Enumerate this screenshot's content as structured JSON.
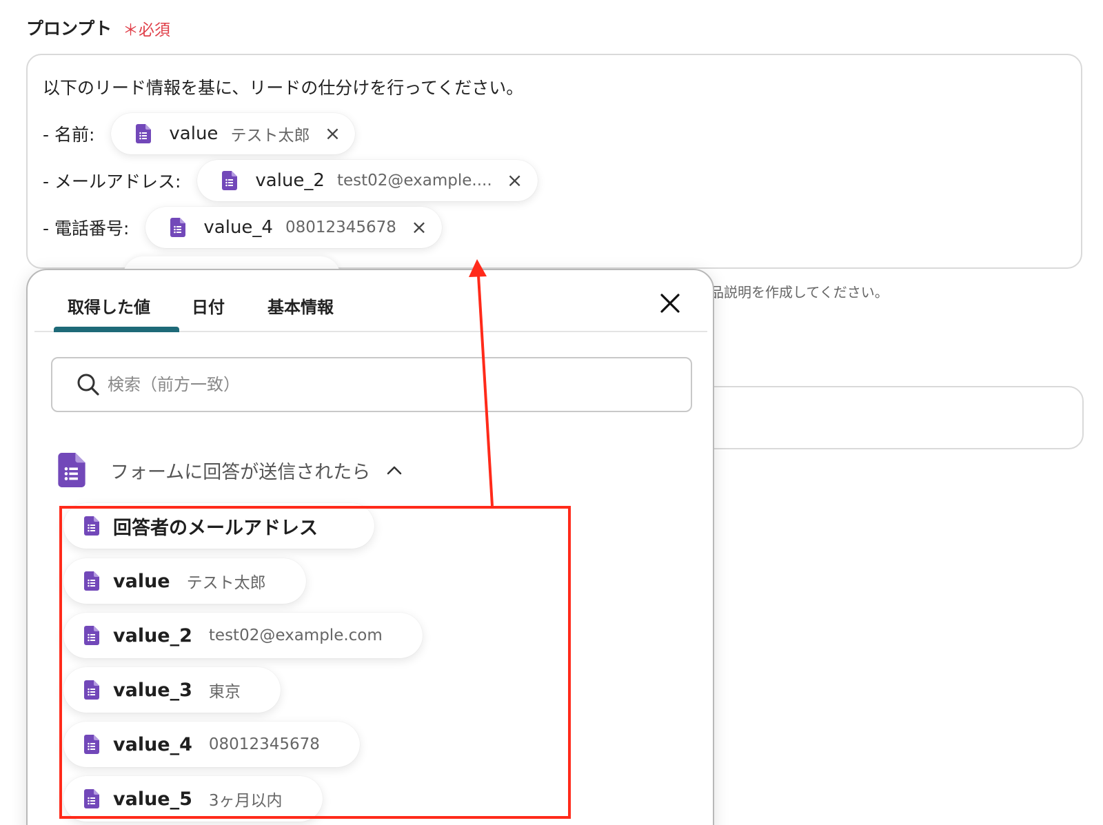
{
  "field": {
    "label": "プロンプト",
    "required": "＊必須"
  },
  "prompt": {
    "intro": "以下のリード情報を基に、リードの仕分けを行ってください。",
    "rows": [
      {
        "label": "- 名前:",
        "chip_name": "value",
        "chip_value": "テスト太郎"
      },
      {
        "label": "- メールアドレス:",
        "chip_name": "value_2",
        "chip_value": "test02@example...."
      },
      {
        "label": "- 電話番号:",
        "chip_name": "value_4",
        "chip_value": "08012345678"
      }
    ],
    "chip_close": "×"
  },
  "helper_text": "品説明を作成してください。",
  "popup": {
    "tabs": [
      "取得した値",
      "日付",
      "基本情報"
    ],
    "active_tab": 0,
    "search_placeholder": "検索（前方一致）",
    "group_title": "フォームに回答が送信されたら",
    "group_chevron": "^",
    "items": [
      {
        "name": "回答者のメールアドレス",
        "value": ""
      },
      {
        "name": "value",
        "value": "テスト太郎"
      },
      {
        "name": "value_2",
        "value": "test02@example.com"
      },
      {
        "name": "value_3",
        "value": "東京"
      },
      {
        "name": "value_4",
        "value": "08012345678"
      },
      {
        "name": "value_5",
        "value": "3ヶ月以内"
      }
    ]
  },
  "colors": {
    "required": "#e0404a",
    "form_icon": "#7248b9",
    "tab_indicator": "#1e6a78",
    "annotation": "#ff2a1a"
  }
}
